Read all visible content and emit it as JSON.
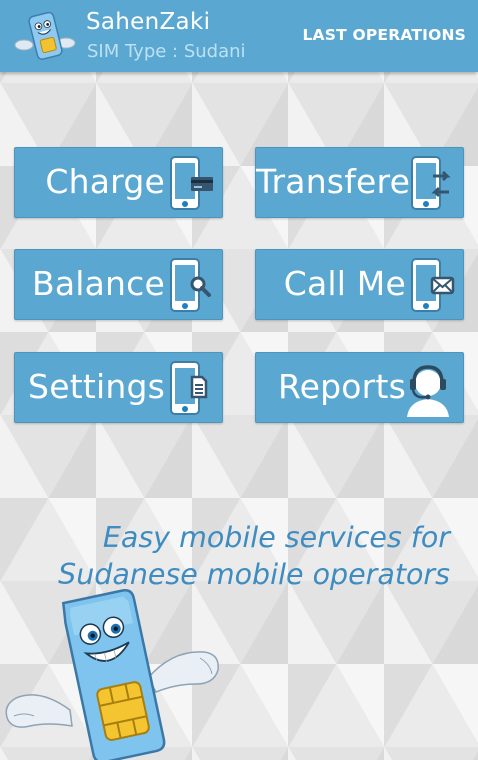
{
  "appbar": {
    "title": "SahenZaki",
    "subtitle": "SIM Type : Sudani",
    "action_label": "LAST OPERATIONS",
    "logo_icon": "sim-mascot-icon"
  },
  "tiles": [
    {
      "label": "Charge",
      "icon": "phone-card-icon"
    },
    {
      "label": "Transfere",
      "icon": "phone-transfer-icon"
    },
    {
      "label": "Balance",
      "icon": "phone-search-icon"
    },
    {
      "label": "Call Me",
      "icon": "phone-mail-icon"
    },
    {
      "label": "Settings",
      "icon": "phone-document-icon"
    },
    {
      "label": "Reports",
      "icon": "support-agent-icon"
    }
  ],
  "tagline": {
    "line1": "Easy mobile services for",
    "line2": "Sudanese mobile operators"
  },
  "colors": {
    "primary": "#5aa8d2",
    "tagline": "#3f8cc0",
    "background": "#e7e7e7"
  }
}
